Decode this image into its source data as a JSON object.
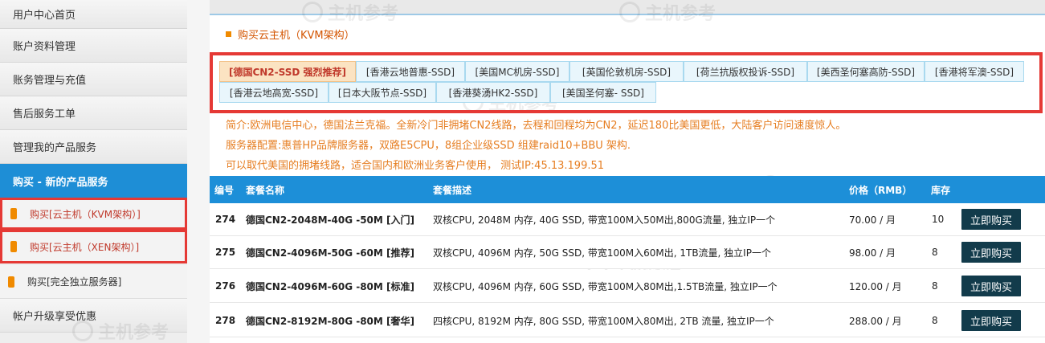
{
  "sidebar": {
    "items": [
      {
        "label": "用户中心首页"
      },
      {
        "label": "账户资料管理"
      },
      {
        "label": "账务管理与充值"
      },
      {
        "label": "售后服务工单"
      },
      {
        "label": "管理我的产品服务"
      },
      {
        "label": "购买 - 新的产品服务"
      }
    ],
    "subitems": [
      {
        "label": "购买[云主机（KVM架构）]"
      },
      {
        "label": "购买[云主机（XEN架构）]"
      },
      {
        "label": "购买[完全独立服务器]"
      }
    ],
    "footer_item": {
      "label": "帐户升级享受优惠"
    }
  },
  "section": {
    "title": "购买云主机（KVM架构）"
  },
  "tabs": [
    {
      "label": "[德国CN2-SSD 强烈推荐]"
    },
    {
      "label": "[香港云地普惠-SSD]"
    },
    {
      "label": "[美国MC机房-SSD]"
    },
    {
      "label": "[英国伦敦机房-SSD]"
    },
    {
      "label": "[荷兰抗版权投诉-SSD]"
    },
    {
      "label": "[美西圣何塞高防-SSD]"
    },
    {
      "label": "[香港将军澳-SSD]"
    },
    {
      "label": "[香港云地高宽-SSD]"
    },
    {
      "label": "[日本大阪节点-SSD]"
    },
    {
      "label": "[香港葵湧HK2-SSD]"
    },
    {
      "label": "[美国圣何塞- SSD]"
    }
  ],
  "description": {
    "line1": "简介:欧洲电信中心，德国法兰克福。全新冷门非拥堵CN2线路，去程和回程均为CN2，延迟180比美国更低，大陆客户访问速度惊人。",
    "line2": "服务器配置:惠普HP品牌服务器，双路E5CPU，8组企业级SSD 组建raid10+BBU 架构.",
    "line3": "可以取代美国的拥堵线路，适合国内和欧洲业务客户使用， 测试IP:45.13.199.51"
  },
  "table": {
    "headers": {
      "id": "编号",
      "name": "套餐名称",
      "desc": "套餐描述",
      "price": "价格（RMB）",
      "stock": "库存"
    },
    "rows": [
      {
        "id": "274",
        "name": "德国CN2-2048M-40G -50M [入门]",
        "desc": "双核CPU, 2048M 内存, 40G SSD, 带宽100M入50M出,800G流量, 独立IP一个",
        "price": "70.00 / 月",
        "stock": "10",
        "button": "立即购买"
      },
      {
        "id": "275",
        "name": "德国CN2-4096M-50G -60M [推荐]",
        "desc": "双核CPU, 4096M 内存, 50G SSD, 带宽100M入60M出, 1TB流量, 独立IP一个",
        "price": "98.00 / 月",
        "stock": "8",
        "button": "立即购买"
      },
      {
        "id": "276",
        "name": "德国CN2-4096M-60G -80M [标准]",
        "desc": "双核CPU, 4096M 内存, 60G SSD, 带宽100M入80M出,1.5TB流量, 独立IP一个",
        "price": "120.00 / 月",
        "stock": "8",
        "button": "立即购买"
      },
      {
        "id": "278",
        "name": "德国CN2-8192M-80G -80M [奢华]",
        "desc": "四核CPU, 8192M 内存, 80G SSD, 带宽100M入80M出, 2TB 流量, 独立IP一个",
        "price": "288.00 / 月",
        "stock": "8",
        "button": "立即购买"
      }
    ]
  },
  "watermark": {
    "text": "主机参考"
  },
  "colors": {
    "accent": "#1d8fd8",
    "highlight": "#e53935",
    "orange": "#e67e22",
    "button": "#123b4b"
  }
}
